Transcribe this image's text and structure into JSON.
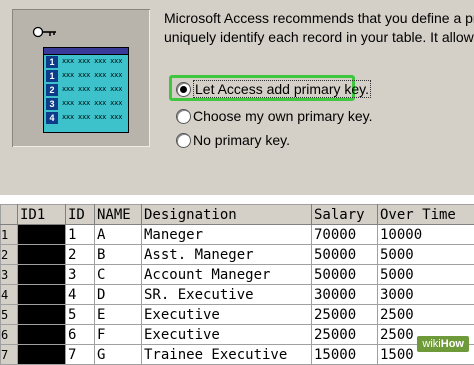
{
  "wizard": {
    "intro_line1": "Microsoft Access recommends that you define a primary",
    "intro_line2": "uniquely identify each record in your table. It allows you",
    "options": [
      {
        "label": "Let Access add primary key.",
        "selected": true
      },
      {
        "label": "Choose my own primary key.",
        "selected": false
      },
      {
        "label": "No primary key.",
        "selected": false
      }
    ],
    "illustration_numbers": [
      "1",
      "2",
      "3",
      "4"
    ],
    "illustration_placeholder": "xxx xxx xxx xxx",
    "highlight_color": "#3ec73e"
  },
  "table": {
    "columns": [
      "",
      "ID1",
      "ID",
      "NAME",
      "Designation",
      "Salary",
      "Over Time"
    ],
    "rows": [
      {
        "row": "1",
        "id1": "",
        "id": "1",
        "name": "A",
        "designation": "Maneger",
        "salary": "70000",
        "overtime": "10000"
      },
      {
        "row": "2",
        "id1": "",
        "id": "2",
        "name": "B",
        "designation": "Asst. Maneger",
        "salary": "50000",
        "overtime": "5000"
      },
      {
        "row": "3",
        "id1": "",
        "id": "3",
        "name": "C",
        "designation": "Account Maneger",
        "salary": "50000",
        "overtime": "5000"
      },
      {
        "row": "4",
        "id1": "",
        "id": "4",
        "name": "D",
        "designation": "SR. Executive",
        "salary": "30000",
        "overtime": "3000"
      },
      {
        "row": "5",
        "id1": "",
        "id": "5",
        "name": "E",
        "designation": "Executive",
        "salary": "25000",
        "overtime": "2500"
      },
      {
        "row": "6",
        "id1": "",
        "id": "6",
        "name": "F",
        "designation": "Executive",
        "salary": "25000",
        "overtime": "2500"
      },
      {
        "row": "7",
        "id1": "",
        "id": "7",
        "name": "G",
        "designation": "Trainee Executive",
        "salary": "15000",
        "overtime": "1500"
      }
    ]
  },
  "watermark": {
    "prefix": "wiki",
    "suffix": "How"
  }
}
